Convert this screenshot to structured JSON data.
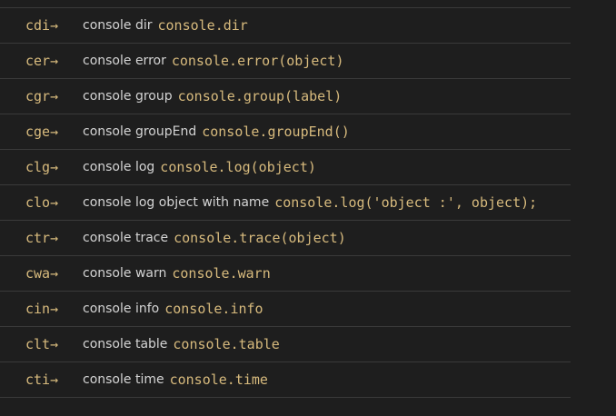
{
  "snippets": [
    {
      "prefix": "cdi→",
      "description": "console dir",
      "code": "console.dir"
    },
    {
      "prefix": "cer→",
      "description": "console error",
      "code": "console.error(object)"
    },
    {
      "prefix": "cgr→",
      "description": "console group",
      "code": "console.group(label)"
    },
    {
      "prefix": "cge→",
      "description": "console groupEnd",
      "code": "console.groupEnd()"
    },
    {
      "prefix": "clg→",
      "description": "console log",
      "code": "console.log(object)"
    },
    {
      "prefix": "clo→",
      "description": "console log object with name",
      "code": "console.log('object :', object);"
    },
    {
      "prefix": "ctr→",
      "description": "console trace",
      "code": "console.trace(object)"
    },
    {
      "prefix": "cwa→",
      "description": "console warn",
      "code": "console.warn"
    },
    {
      "prefix": "cin→",
      "description": "console info",
      "code": "console.info"
    },
    {
      "prefix": "clt→",
      "description": "console table",
      "code": "console.table"
    },
    {
      "prefix": "cti→",
      "description": "console time",
      "code": "console.time"
    }
  ],
  "colors": {
    "background": "#1e1e1e",
    "prefix": "#d7ba7d",
    "description": "#d4d4d4",
    "code": "#d7ba7d",
    "divider": "#3a3a3a"
  }
}
